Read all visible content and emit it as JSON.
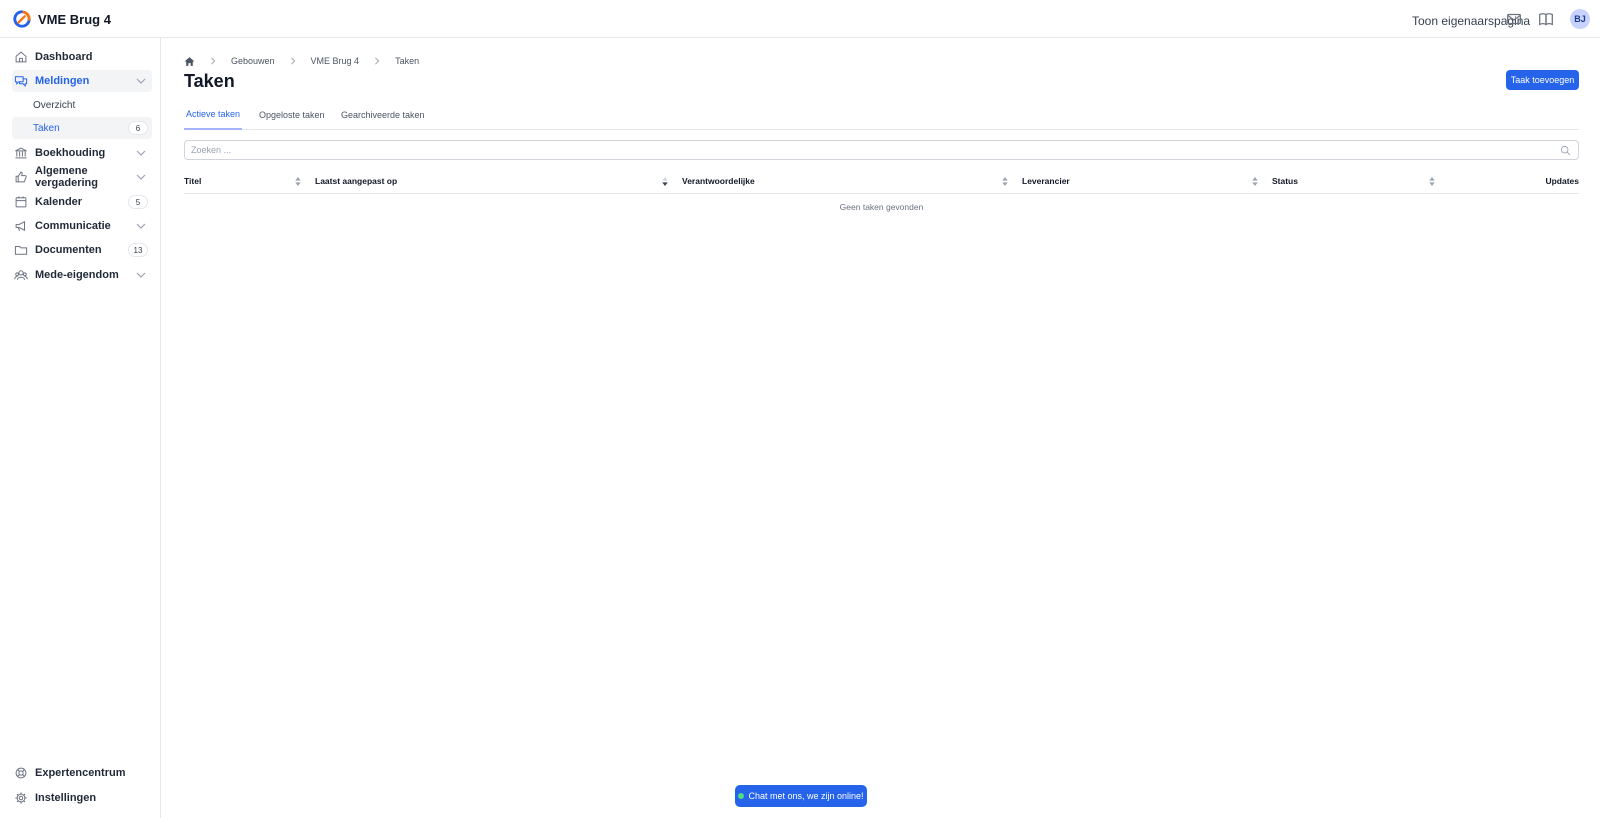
{
  "app": {
    "brand": "VME Brug 4"
  },
  "topbar": {
    "owner_link": "Toon eigenaarspagina",
    "avatar_initials": "BJ"
  },
  "sidebar": {
    "items": [
      {
        "label": "Dashboard",
        "icon": "home-icon"
      },
      {
        "label": "Meldingen",
        "icon": "chat-icon",
        "expanded": true,
        "children": [
          {
            "label": "Overzicht"
          },
          {
            "label": "Taken",
            "badge": "6"
          }
        ]
      },
      {
        "label": "Boekhouding",
        "icon": "bank-icon"
      },
      {
        "label": "Algemene vergadering",
        "icon": "thumbs-up-icon"
      },
      {
        "label": "Kalender",
        "icon": "calendar-icon",
        "badge": "5"
      },
      {
        "label": "Communicatie",
        "icon": "megaphone-icon"
      },
      {
        "label": "Documenten",
        "icon": "folder-icon",
        "badge": "13"
      },
      {
        "label": "Mede-eigendom",
        "icon": "users-icon"
      }
    ],
    "bottom": [
      {
        "label": "Expertencentrum",
        "icon": "lifebuoy-icon"
      },
      {
        "label": "Instellingen",
        "icon": "gear-icon"
      }
    ]
  },
  "breadcrumb": [
    "Gebouwen",
    "VME Brug 4",
    "Taken"
  ],
  "page": {
    "title": "Taken",
    "add_button": "Taak toevoegen"
  },
  "tabs": [
    "Actieve taken",
    "Opgeloste taken",
    "Gearchiveerde taken"
  ],
  "search": {
    "placeholder": "Zoeken ...",
    "value": ""
  },
  "table": {
    "columns": [
      "Titel",
      "Laatst aangepast op",
      "Verantwoordelijke",
      "Leverancier",
      "Status",
      "Updates"
    ],
    "rows": [],
    "empty_text": "Geen taken gevonden"
  },
  "chat": {
    "label": "Chat met ons, we zijn online!"
  },
  "colors": {
    "accent": "#2563eb",
    "online": "#4ade80",
    "logo_blue": "#2563eb",
    "logo_orange": "#f97316"
  }
}
